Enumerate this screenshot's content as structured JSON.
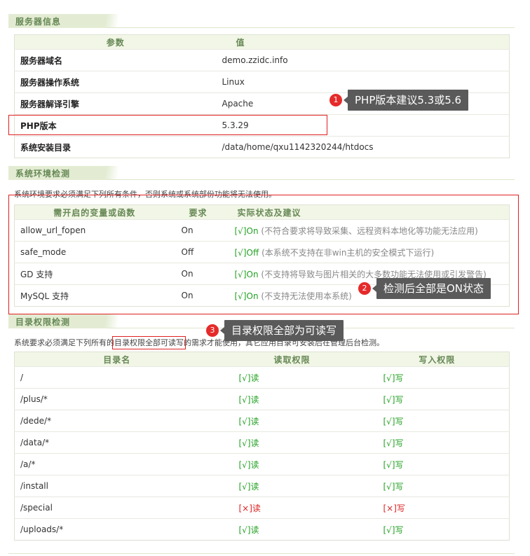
{
  "server": {
    "title": "服务器信息",
    "headers": [
      "参数",
      "值"
    ],
    "rows": [
      {
        "label": "服务器域名",
        "value": "demo.zzidc.info"
      },
      {
        "label": "服务器操作系统",
        "value": "Linux"
      },
      {
        "label": "服务器解译引擎",
        "value": "Apache"
      },
      {
        "label": "PHP版本",
        "value": "5.3.29"
      },
      {
        "label": "系统安装目录",
        "value": "/data/home/qxu1142320244/htdocs"
      }
    ]
  },
  "env": {
    "title": "系统环境检测",
    "desc": "系统环境要求必须满足下列所有条件，否则系统或系统部份功能将无法使用。",
    "headers": [
      "需开启的变量或函数",
      "要求",
      "实际状态及建议"
    ],
    "rows": [
      {
        "name": "allow_url_fopen",
        "req": "On",
        "status": "[√]On",
        "tip": "(不符合要求将导致采集、远程资料本地化等功能无法应用)"
      },
      {
        "name": "safe_mode",
        "req": "Off",
        "status": "[√]Off",
        "tip": "(本系统不支持在非win主机的安全模式下运行)"
      },
      {
        "name": "GD 支持",
        "req": "On",
        "status": "[√]On",
        "tip": "(不支持将导致与图片相关的大多数功能无法使用或引发警告)"
      },
      {
        "name": "MySQL 支持",
        "req": "On",
        "status": "[√]On",
        "tip": "(不支持无法使用本系统)"
      }
    ]
  },
  "dir": {
    "title": "目录权限检测",
    "desc_pre": "系统要求必须满足下列所有的",
    "desc_highlight": "目录权限全部可读写",
    "desc_post": "的需求才能使用，其它应用目录可安装后在管理后台检测。",
    "headers": [
      "目录名",
      "读取权限",
      "写入权限"
    ],
    "rows": [
      {
        "path": "/",
        "read": "[√]读",
        "write": "[√]写",
        "ok": true
      },
      {
        "path": "/plus/*",
        "read": "[√]读",
        "write": "[√]写",
        "ok": true
      },
      {
        "path": "/dede/*",
        "read": "[√]读",
        "write": "[√]写",
        "ok": true
      },
      {
        "path": "/data/*",
        "read": "[√]读",
        "write": "[√]写",
        "ok": true
      },
      {
        "path": "/a/*",
        "read": "[√]读",
        "write": "[√]写",
        "ok": true
      },
      {
        "path": "/install",
        "read": "[√]读",
        "write": "[√]写",
        "ok": true
      },
      {
        "path": "/special",
        "read": "[×]读",
        "write": "[×]写",
        "ok": false
      },
      {
        "path": "/uploads/*",
        "read": "[√]读",
        "write": "[√]写",
        "ok": true
      }
    ]
  },
  "annotations": [
    {
      "num": "1",
      "text": "PHP版本建议5.3或5.6"
    },
    {
      "num": "2",
      "text": "检测后全部是ON状态"
    },
    {
      "num": "3",
      "text": "目录权限全部为可读写"
    }
  ],
  "colors": {
    "ok": "#22a022",
    "bad": "#dd2222",
    "annotation_red": "#e02020",
    "header_green": "#668855"
  }
}
